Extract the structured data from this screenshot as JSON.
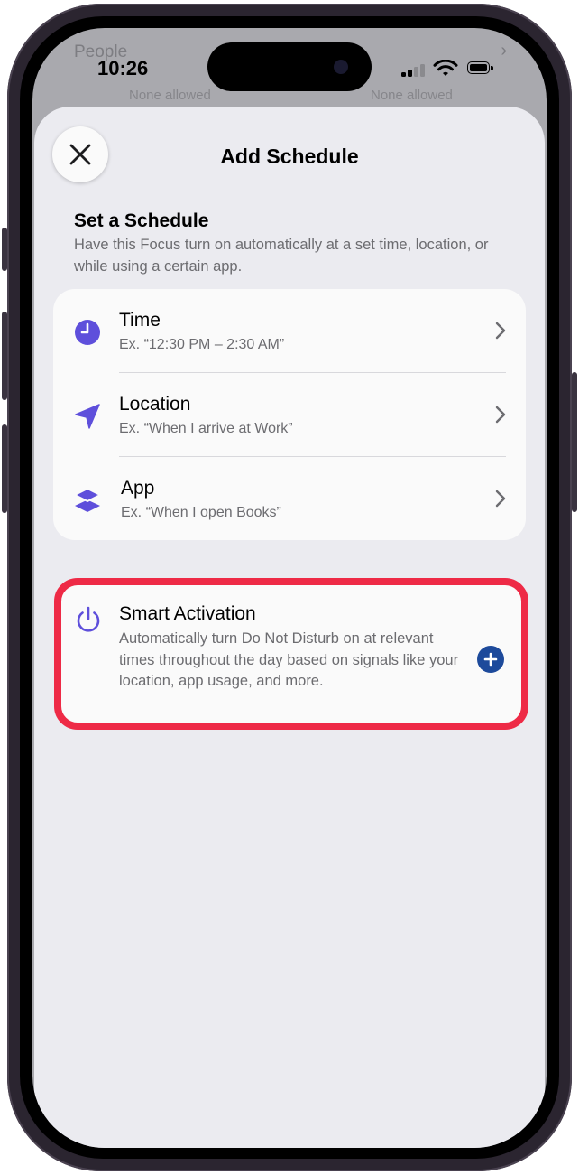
{
  "background_list": {
    "people_label": "People",
    "none_allowed_left": "None allowed",
    "none_allowed_right": "None allowed"
  },
  "status_bar": {
    "time": "10:26"
  },
  "sheet": {
    "title": "Add Schedule",
    "close_icon": "xmark-icon"
  },
  "schedule": {
    "heading": "Set a Schedule",
    "description": "Have this Focus turn on automatically at a set time, location, or while using a certain app.",
    "options": [
      {
        "label": "Time",
        "example": "Ex. “12:30 PM – 2:30 AM”",
        "icon": "clock-icon",
        "color": "#5e4fdb"
      },
      {
        "label": "Location",
        "example": "Ex. “When I arrive at Work”",
        "icon": "location-arrow-icon",
        "color": "#5e4fdb"
      },
      {
        "label": "App",
        "example": "Ex. “When I open Books”",
        "icon": "app-stack-icon",
        "color": "#5e4fdb"
      }
    ]
  },
  "smart_activation": {
    "title": "Smart Activation",
    "description": "Automatically turn Do Not Disturb on at relevant times throughout the day based on signals like your location, app usage, and more.",
    "icon": "power-icon",
    "highlight_color": "#ee2a46",
    "add_button_color": "#1d4a9b"
  }
}
